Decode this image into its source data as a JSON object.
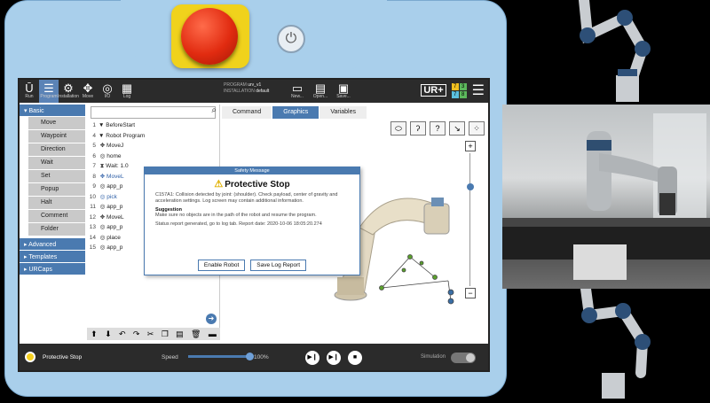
{
  "header": {
    "run_label": "Run",
    "program_label": "Program",
    "installation_label": "Installation",
    "move_label": "Move",
    "io_label": "I/O",
    "log_label": "Log",
    "program_caption": "PROGRAM",
    "program_name": "urv_v1",
    "installation_caption": "INSTALLATION",
    "installation_name": "default",
    "new_label": "New...",
    "open_label": "Open...",
    "save_label": "Save...",
    "status_numbers": [
      "7",
      "3",
      "7",
      "8"
    ]
  },
  "nav": {
    "basic": "Basic",
    "items": [
      "Move",
      "Waypoint",
      "Direction",
      "Wait",
      "Set",
      "Popup",
      "Halt",
      "Comment",
      "Folder"
    ],
    "advanced": "Advanced",
    "templates": "Templates",
    "urcaps": "URCaps"
  },
  "tree": {
    "rows": [
      {
        "ln": "1",
        "txt": "▼ BeforeStart"
      },
      {
        "ln": "4",
        "txt": "▼ Robot Program"
      },
      {
        "ln": "5",
        "txt": "   ✥ MoveJ"
      },
      {
        "ln": "6",
        "txt": "      ◎ home"
      },
      {
        "ln": "7",
        "txt": "      ⧗ Wait: 1.0"
      },
      {
        "ln": "8",
        "txt": "   ✥ MoveL"
      },
      {
        "ln": "9",
        "txt": "      ◎ app_p"
      },
      {
        "ln": "10",
        "txt": "      ◎ pick"
      },
      {
        "ln": "11",
        "txt": "      ◎ app_p"
      },
      {
        "ln": "12",
        "txt": "   ✥ MoveL"
      },
      {
        "ln": "13",
        "txt": "      ◎ app_p"
      },
      {
        "ln": "14",
        "txt": "      ◎ place"
      },
      {
        "ln": "15",
        "txt": "      ◎ app_p"
      }
    ]
  },
  "tabs": [
    "Command",
    "Graphics",
    "Variables"
  ],
  "dialog": {
    "title": "Safety Message",
    "heading": "Protective Stop",
    "message": "C157A1: Collision detected by joint: (shoulder). Check payload, center of gravity and acceleration settings. Log screen may contain additional information.",
    "suggestion_label": "Suggestion",
    "suggestion": "Make sure no objects are in the path of the robot and resume the program.",
    "report": "Status report generated, go to log tab. Report date: 2020-10-06 18:05:20.274",
    "enable_button": "Enable Robot",
    "save_log_button": "Save Log Report"
  },
  "footer": {
    "status": "Protective Stop",
    "speed_label": "Speed",
    "speed_value": "100%",
    "speed_fraction": 1.0,
    "simulation_label": "Simulation"
  },
  "colors": {
    "pendant": "#a9cfeb",
    "accent": "#4a7ab0",
    "estop": "#e12b10",
    "estop_housing": "#f0d21c",
    "status": "#f5d020"
  }
}
